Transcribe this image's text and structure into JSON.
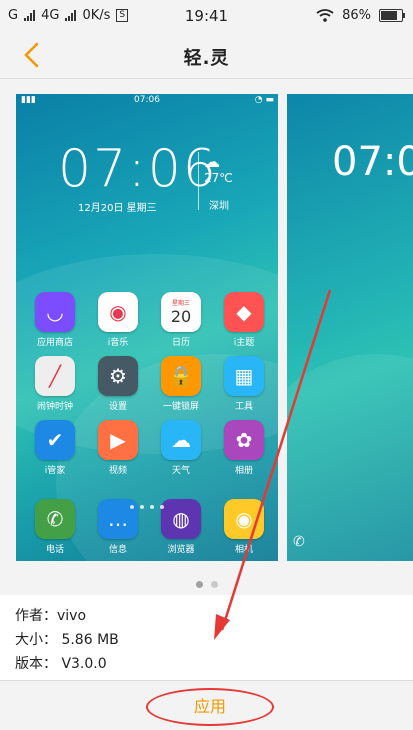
{
  "status_bar": {
    "carrier1": "G",
    "carrier2": "4G",
    "speed": "0K/s",
    "time": "19:41",
    "battery": "86%"
  },
  "header": {
    "title": "轻.灵"
  },
  "preview": {
    "status_time": "07:06",
    "clock": "07:06",
    "date": "12月20日   星期三",
    "temperature": "27℃",
    "city": "深圳",
    "apps": [
      {
        "label": "应用商店",
        "icon": "store-icon",
        "color": "#7c4dff"
      },
      {
        "label": "i音乐",
        "icon": "music-icon",
        "color": "#ffffff"
      },
      {
        "label": "日历",
        "icon": "calendar-icon",
        "color": "#ffffff"
      },
      {
        "label": "i主题",
        "icon": "theme-icon",
        "color": "#ff5252"
      },
      {
        "label": "闹钟时钟",
        "icon": "clock-icon",
        "color": "#eeeeee"
      },
      {
        "label": "设置",
        "icon": "gear-icon",
        "color": "#455a64"
      },
      {
        "label": "一键锁屏",
        "icon": "lock-icon",
        "color": "#ff9800"
      },
      {
        "label": "工具",
        "icon": "tools-icon",
        "color": "#29b6f6"
      },
      {
        "label": "i管家",
        "icon": "shield-icon",
        "color": "#1e88e5"
      },
      {
        "label": "视频",
        "icon": "video-icon",
        "color": "#ff7043"
      },
      {
        "label": "天气",
        "icon": "weather-icon",
        "color": "#29b6f6"
      },
      {
        "label": "相册",
        "icon": "gallery-icon",
        "color": "#ab47bc"
      },
      {
        "label": "电话",
        "icon": "phone-icon",
        "color": "#43a047"
      },
      {
        "label": "信息",
        "icon": "message-icon",
        "color": "#1e88e5"
      },
      {
        "label": "浏览器",
        "icon": "browser-icon",
        "color": "#5e35b1"
      },
      {
        "label": "相机",
        "icon": "camera-icon",
        "color": "#ffca28"
      }
    ],
    "calendar_day": "20",
    "calendar_weekday": "星期三",
    "second_clock": "07:0"
  },
  "info": {
    "author": "作者：vivo",
    "size": "大小：  5.86 MB",
    "version": "版本：  V3.0.0"
  },
  "actions": {
    "apply": "应用"
  }
}
